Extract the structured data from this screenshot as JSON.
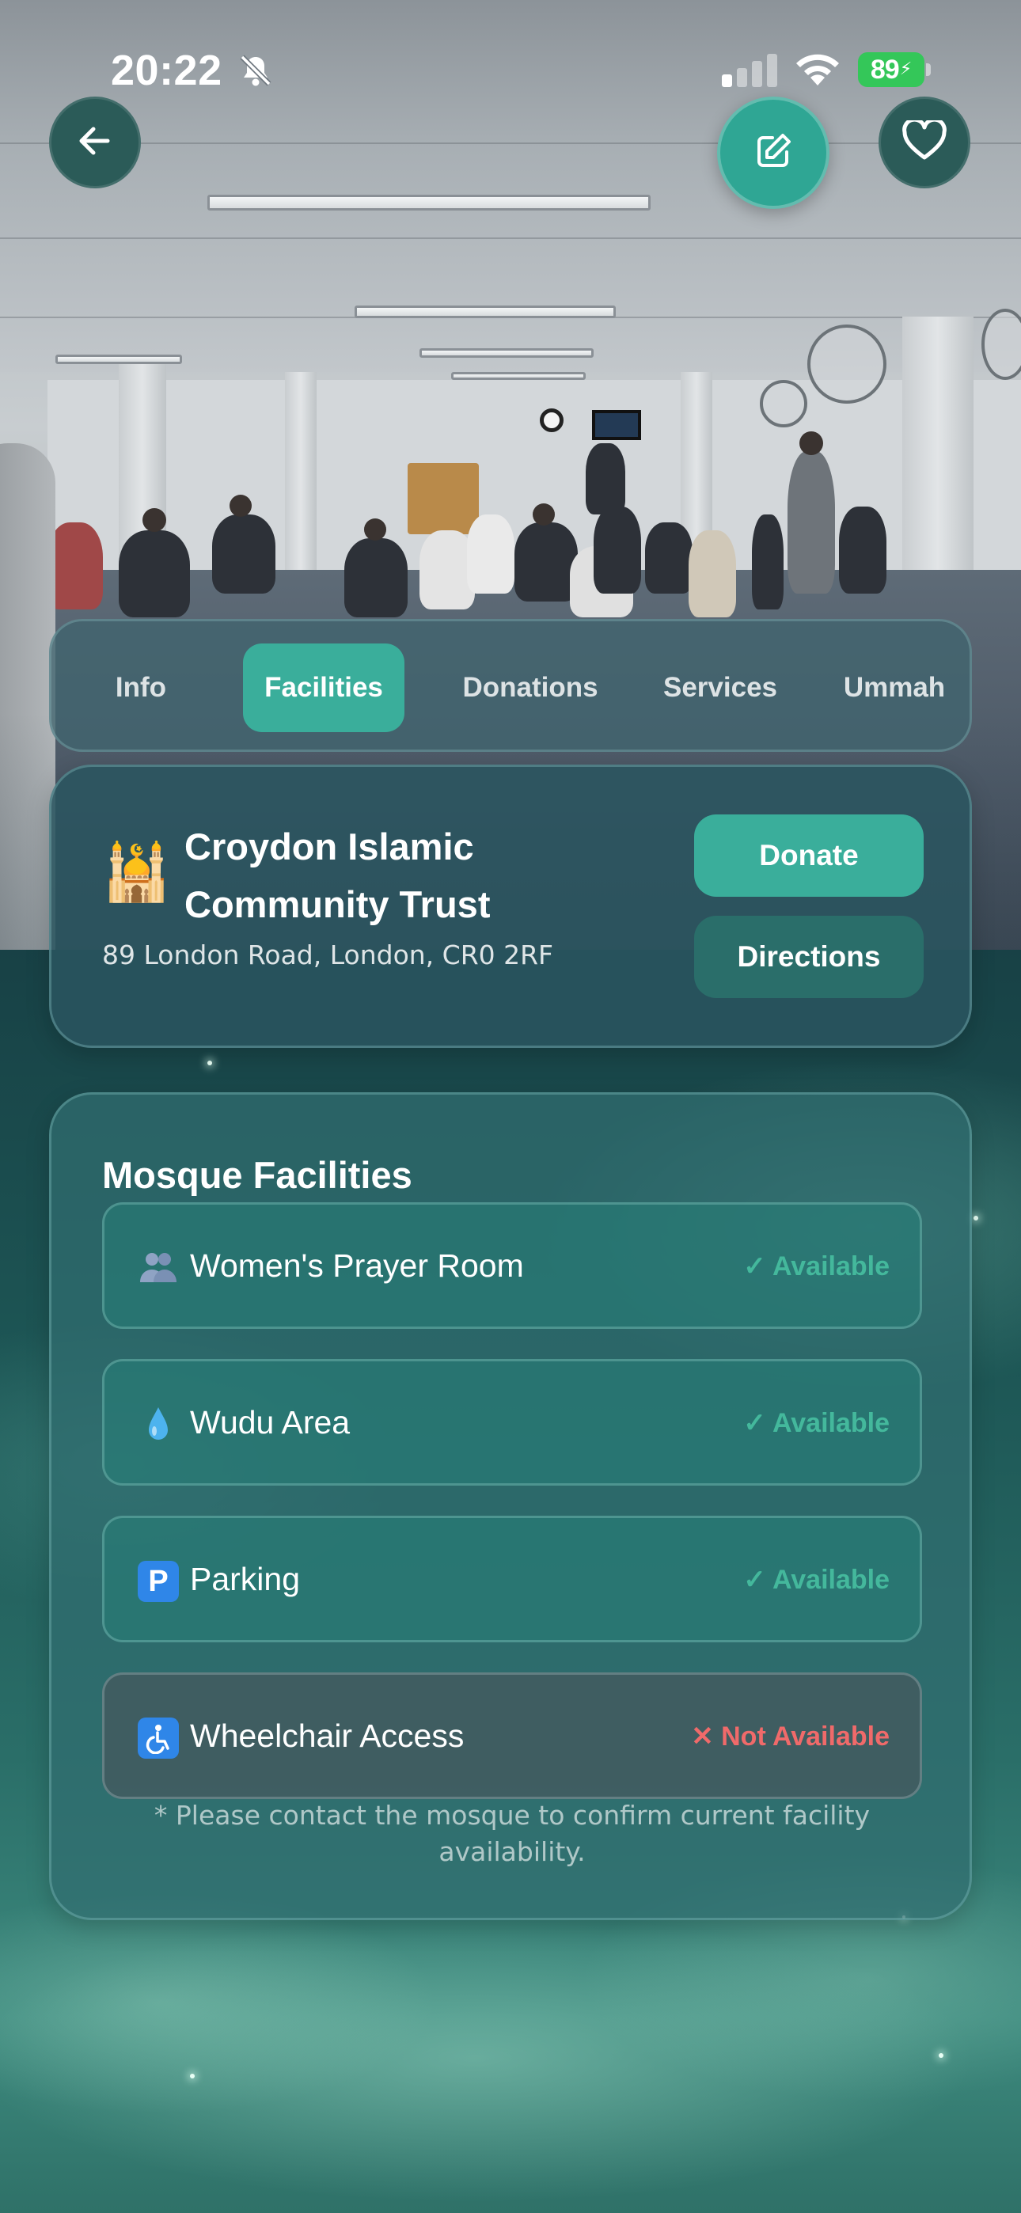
{
  "status_bar": {
    "time": "20:22",
    "battery": "89"
  },
  "tabs": [
    {
      "label": "Info",
      "active": false
    },
    {
      "label": "Facilities",
      "active": true
    },
    {
      "label": "Donations",
      "active": false
    },
    {
      "label": "Services",
      "active": false
    },
    {
      "label": "Ummah",
      "active": false
    }
  ],
  "mosque": {
    "icon": "mosque-icon",
    "name_line1": "Croydon Islamic",
    "name_line2": "Community Trust",
    "address": "89 London Road, London, CR0 2RF",
    "donate_label": "Donate",
    "directions_label": "Directions"
  },
  "facilities": {
    "title": "Mosque Facilities",
    "items": [
      {
        "icon": "women-icon",
        "label": "Women's Prayer Room",
        "status": "✓ Available",
        "available": true
      },
      {
        "icon": "droplet-icon",
        "label": "Wudu Area",
        "status": "✓ Available",
        "available": true
      },
      {
        "icon": "parking-icon",
        "label": "Parking",
        "status": "✓ Available",
        "available": true
      },
      {
        "icon": "wheelchair-icon",
        "label": "Wheelchair Access",
        "status": "✕ Not Available",
        "available": false
      }
    ],
    "note": "* Please contact the mosque to confirm current facility availability."
  },
  "colors": {
    "accent": "#3aae9b",
    "available": "#44b89c",
    "not_available": "#f06a6a",
    "battery": "#34c759"
  }
}
